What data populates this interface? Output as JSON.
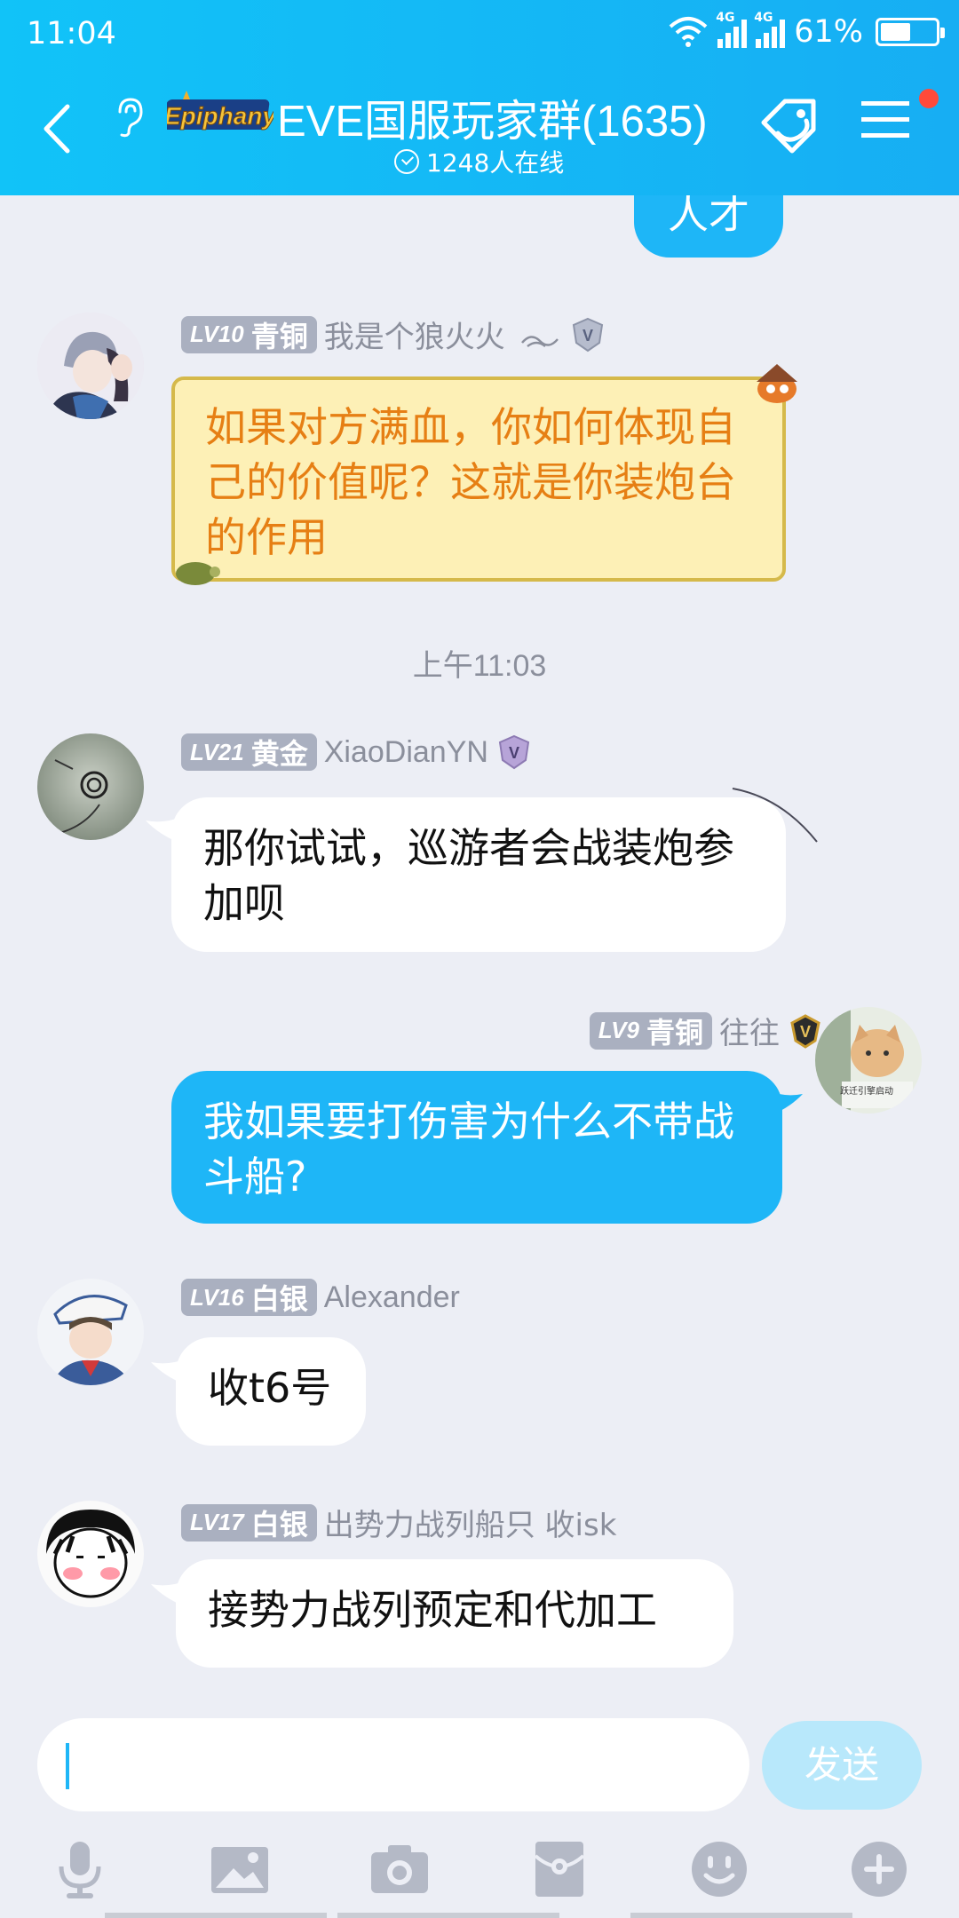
{
  "status_bar": {
    "time": "11:04",
    "network_1": "4G",
    "network_2": "4G",
    "battery": "61%",
    "battery_level": 0.61
  },
  "header": {
    "logo_text": "Epiphany",
    "title": "EVE国服玩家群(1635)",
    "online_count": "1248人在线",
    "colors": {
      "bar": "#17aef3",
      "notification_dot": "#ff4a3a"
    }
  },
  "messages": [
    {
      "partial_text": "人才",
      "from_self": true
    },
    {
      "level": "LV10",
      "rank": "青铜",
      "sender": "我是个狼火火",
      "text": "如果对方满血，你如何体现自己的价值呢？这就是你装炮台的作用",
      "style": "gold"
    },
    {
      "timestamp": "上午11:03"
    },
    {
      "level": "LV21",
      "rank": "黄金",
      "sender": "XiaoDianYN",
      "text": "那你试试，巡游者会战装炮参加呗",
      "style": "white"
    },
    {
      "level": "LV9",
      "rank": "青铜",
      "sender": "往往",
      "text": "我如果要打伤害为什么不带战斗船?",
      "style": "blue",
      "from_self": true,
      "avatar_caption": "跃迁引擎启动"
    },
    {
      "level": "LV16",
      "rank": "白银",
      "sender": "Alexander",
      "text": "收t6号",
      "style": "white"
    },
    {
      "level": "LV17",
      "rank": "白银",
      "sender": "出势力战列船只 收isk",
      "text": "接势力战列预定和代加工",
      "style": "white"
    }
  ],
  "composer": {
    "value": "",
    "send_label": "发送"
  },
  "toolbar": {
    "icons": [
      "microphone-icon",
      "image-icon",
      "camera-icon",
      "red-packet-icon",
      "emoji-icon",
      "plus-icon"
    ]
  }
}
